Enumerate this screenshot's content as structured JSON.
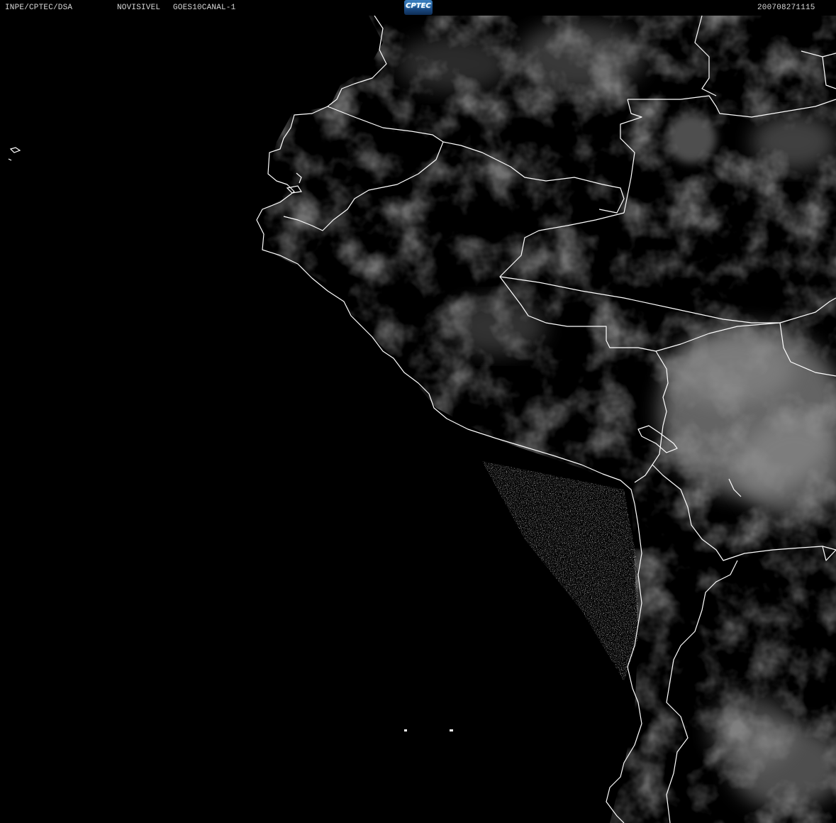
{
  "header": {
    "organization": "INPE/CPTEC/DSA",
    "product": "NOVISIVEL",
    "satellite": "GOES10CANAL-1",
    "timestamp": "200708271115",
    "logo_text": "CPTEC"
  },
  "image": {
    "type": "satellite visible-channel image",
    "background_color": "#000000",
    "cloud_color": "#8a8a8a",
    "border_color": "#ffffff"
  }
}
